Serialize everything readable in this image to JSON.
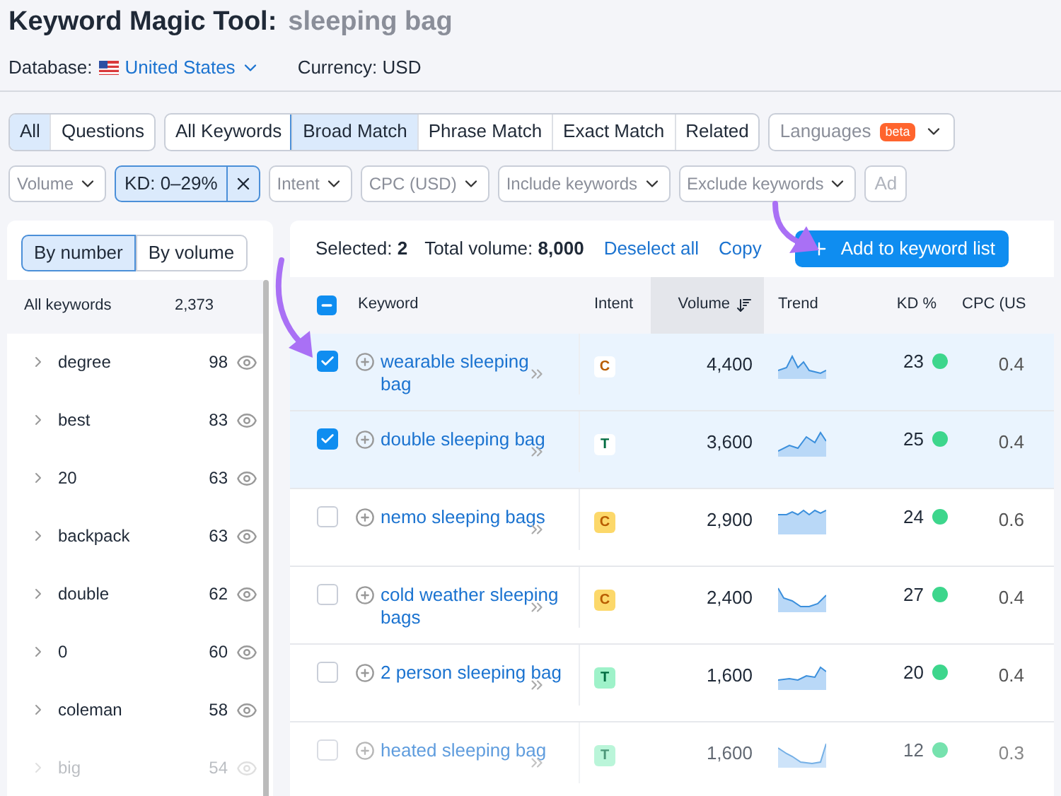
{
  "header": {
    "title": "Keyword Magic Tool:",
    "query": "sleeping bag",
    "database_label": "Database:",
    "database": "United States",
    "currency": "Currency: USD"
  },
  "tab_groups": [
    [
      {
        "label": "All",
        "selected": true
      },
      {
        "label": "Questions",
        "selected": false
      }
    ],
    [
      {
        "label": "All Keywords",
        "selected": false
      },
      {
        "label": "Broad Match",
        "selected": true
      },
      {
        "label": "Phrase Match",
        "selected": false
      },
      {
        "label": "Exact Match",
        "selected": false
      },
      {
        "label": "Related",
        "selected": false
      }
    ]
  ],
  "languages": {
    "label": "Languages",
    "badge": "beta"
  },
  "filters": [
    {
      "kind": "dropdown",
      "label": "Volume"
    },
    {
      "kind": "active",
      "label": "KD: 0–29%"
    },
    {
      "kind": "dropdown",
      "label": "Intent"
    },
    {
      "kind": "dropdown",
      "label": "CPC (USD)"
    },
    {
      "kind": "dropdown",
      "label": "Include keywords"
    },
    {
      "kind": "dropdown",
      "label": "Exclude keywords"
    },
    {
      "kind": "cut",
      "label": "Ad"
    }
  ],
  "sidebar": {
    "toggle": [
      {
        "label": "By number",
        "selected": true
      },
      {
        "label": "By volume",
        "selected": false
      }
    ],
    "all_label": "All keywords",
    "all_count": "2,373",
    "groups": [
      {
        "name": "degree",
        "count": "98"
      },
      {
        "name": "best",
        "count": "83"
      },
      {
        "name": "20",
        "count": "63"
      },
      {
        "name": "backpack",
        "count": "63"
      },
      {
        "name": "double",
        "count": "62"
      },
      {
        "name": "0",
        "count": "60"
      },
      {
        "name": "coleman",
        "count": "58"
      },
      {
        "name": "big",
        "count": "54"
      }
    ]
  },
  "toolbar": {
    "selected": "Selected: **2**",
    "total": "Total volume: **8,000**",
    "deselect": "Deselect all",
    "copy": "Copy",
    "add": "Add to keyword list"
  },
  "select_all": {
    "indeterminate": true
  },
  "columns": [
    {
      "label": "Keyword",
      "sorted": false
    },
    {
      "label": "Intent",
      "sorted": false
    },
    {
      "label": "Volume",
      "sorted": true
    },
    {
      "label": "Trend",
      "sorted": false
    },
    {
      "label": "KD %",
      "sorted": false
    },
    {
      "label": "CPC (US",
      "sorted": false
    }
  ],
  "rows": [
    {
      "checked": true,
      "keyword": "wearable sleeping bag",
      "intent": {
        "kind": "commercial",
        "label": "C"
      },
      "volume": "4,400",
      "kd": "23",
      "cpc": "0.4"
    },
    {
      "checked": true,
      "keyword": "double sleeping bag",
      "intent": {
        "kind": "transactional",
        "label": "T"
      },
      "volume": "3,600",
      "kd": "25",
      "cpc": "0.4"
    },
    {
      "checked": false,
      "keyword": "nemo sleeping bags",
      "intent": {
        "kind": "commercial",
        "label": "C"
      },
      "volume": "2,900",
      "kd": "24",
      "cpc": "0.6"
    },
    {
      "checked": false,
      "keyword": "cold weather sleeping bags",
      "intent": {
        "kind": "commercial",
        "label": "C"
      },
      "volume": "2,400",
      "kd": "27",
      "cpc": "0.4"
    },
    {
      "checked": false,
      "keyword": "2 person sleeping bag",
      "intent": {
        "kind": "transactional",
        "label": "T"
      },
      "volume": "1,600",
      "kd": "20",
      "cpc": "0.4"
    },
    {
      "checked": false,
      "keyword": "heated sleeping bag",
      "intent": {
        "kind": "transactional",
        "label": "T"
      },
      "volume": "1,600",
      "kd": "12",
      "cpc": "0.3"
    }
  ]
}
